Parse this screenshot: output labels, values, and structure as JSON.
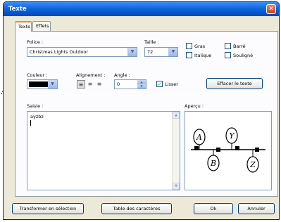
{
  "window": {
    "title": "Texte"
  },
  "tabs": [
    {
      "label": "Texte"
    },
    {
      "label": "Effets"
    }
  ],
  "font": {
    "label": "Police :",
    "value": "Christmas Lights Outdoor"
  },
  "size": {
    "label": "Taille :",
    "value": "72"
  },
  "styles": {
    "bold": {
      "label": "Gras",
      "checked": false
    },
    "italic": {
      "label": "Italique",
      "checked": false
    },
    "strike": {
      "label": "Barré",
      "checked": false
    },
    "underline": {
      "label": "Souligné",
      "checked": false
    }
  },
  "color": {
    "label": "Couleur :",
    "value": "#000000"
  },
  "alignment": {
    "label": "Alignement :",
    "options": [
      "left",
      "center",
      "right"
    ],
    "selected": "left"
  },
  "angle": {
    "label": "Angle :",
    "value": "0"
  },
  "smooth": {
    "label": "Lisser",
    "checked": true
  },
  "clear_button": "Effacer le texte",
  "input": {
    "label": "Saisie :",
    "value": "ayzbz"
  },
  "preview": {
    "label": "Aperçu :",
    "letters": [
      "A",
      "Y",
      "B",
      "Z"
    ]
  },
  "footer": {
    "convert_button": "Transformer en sélection",
    "charmap_button": "Table des caractères",
    "ok_button": "Ok",
    "cancel_button": "Annuler"
  }
}
